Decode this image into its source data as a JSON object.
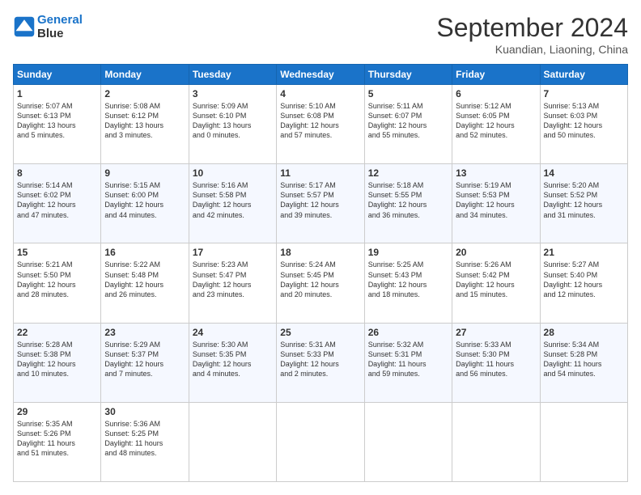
{
  "header": {
    "logo_line1": "General",
    "logo_line2": "Blue",
    "month": "September 2024",
    "location": "Kuandian, Liaoning, China"
  },
  "weekdays": [
    "Sunday",
    "Monday",
    "Tuesday",
    "Wednesday",
    "Thursday",
    "Friday",
    "Saturday"
  ],
  "weeks": [
    [
      {
        "day": "1",
        "lines": [
          "Sunrise: 5:07 AM",
          "Sunset: 6:13 PM",
          "Daylight: 13 hours",
          "and 5 minutes."
        ]
      },
      {
        "day": "2",
        "lines": [
          "Sunrise: 5:08 AM",
          "Sunset: 6:12 PM",
          "Daylight: 13 hours",
          "and 3 minutes."
        ]
      },
      {
        "day": "3",
        "lines": [
          "Sunrise: 5:09 AM",
          "Sunset: 6:10 PM",
          "Daylight: 13 hours",
          "and 0 minutes."
        ]
      },
      {
        "day": "4",
        "lines": [
          "Sunrise: 5:10 AM",
          "Sunset: 6:08 PM",
          "Daylight: 12 hours",
          "and 57 minutes."
        ]
      },
      {
        "day": "5",
        "lines": [
          "Sunrise: 5:11 AM",
          "Sunset: 6:07 PM",
          "Daylight: 12 hours",
          "and 55 minutes."
        ]
      },
      {
        "day": "6",
        "lines": [
          "Sunrise: 5:12 AM",
          "Sunset: 6:05 PM",
          "Daylight: 12 hours",
          "and 52 minutes."
        ]
      },
      {
        "day": "7",
        "lines": [
          "Sunrise: 5:13 AM",
          "Sunset: 6:03 PM",
          "Daylight: 12 hours",
          "and 50 minutes."
        ]
      }
    ],
    [
      {
        "day": "8",
        "lines": [
          "Sunrise: 5:14 AM",
          "Sunset: 6:02 PM",
          "Daylight: 12 hours",
          "and 47 minutes."
        ]
      },
      {
        "day": "9",
        "lines": [
          "Sunrise: 5:15 AM",
          "Sunset: 6:00 PM",
          "Daylight: 12 hours",
          "and 44 minutes."
        ]
      },
      {
        "day": "10",
        "lines": [
          "Sunrise: 5:16 AM",
          "Sunset: 5:58 PM",
          "Daylight: 12 hours",
          "and 42 minutes."
        ]
      },
      {
        "day": "11",
        "lines": [
          "Sunrise: 5:17 AM",
          "Sunset: 5:57 PM",
          "Daylight: 12 hours",
          "and 39 minutes."
        ]
      },
      {
        "day": "12",
        "lines": [
          "Sunrise: 5:18 AM",
          "Sunset: 5:55 PM",
          "Daylight: 12 hours",
          "and 36 minutes."
        ]
      },
      {
        "day": "13",
        "lines": [
          "Sunrise: 5:19 AM",
          "Sunset: 5:53 PM",
          "Daylight: 12 hours",
          "and 34 minutes."
        ]
      },
      {
        "day": "14",
        "lines": [
          "Sunrise: 5:20 AM",
          "Sunset: 5:52 PM",
          "Daylight: 12 hours",
          "and 31 minutes."
        ]
      }
    ],
    [
      {
        "day": "15",
        "lines": [
          "Sunrise: 5:21 AM",
          "Sunset: 5:50 PM",
          "Daylight: 12 hours",
          "and 28 minutes."
        ]
      },
      {
        "day": "16",
        "lines": [
          "Sunrise: 5:22 AM",
          "Sunset: 5:48 PM",
          "Daylight: 12 hours",
          "and 26 minutes."
        ]
      },
      {
        "day": "17",
        "lines": [
          "Sunrise: 5:23 AM",
          "Sunset: 5:47 PM",
          "Daylight: 12 hours",
          "and 23 minutes."
        ]
      },
      {
        "day": "18",
        "lines": [
          "Sunrise: 5:24 AM",
          "Sunset: 5:45 PM",
          "Daylight: 12 hours",
          "and 20 minutes."
        ]
      },
      {
        "day": "19",
        "lines": [
          "Sunrise: 5:25 AM",
          "Sunset: 5:43 PM",
          "Daylight: 12 hours",
          "and 18 minutes."
        ]
      },
      {
        "day": "20",
        "lines": [
          "Sunrise: 5:26 AM",
          "Sunset: 5:42 PM",
          "Daylight: 12 hours",
          "and 15 minutes."
        ]
      },
      {
        "day": "21",
        "lines": [
          "Sunrise: 5:27 AM",
          "Sunset: 5:40 PM",
          "Daylight: 12 hours",
          "and 12 minutes."
        ]
      }
    ],
    [
      {
        "day": "22",
        "lines": [
          "Sunrise: 5:28 AM",
          "Sunset: 5:38 PM",
          "Daylight: 12 hours",
          "and 10 minutes."
        ]
      },
      {
        "day": "23",
        "lines": [
          "Sunrise: 5:29 AM",
          "Sunset: 5:37 PM",
          "Daylight: 12 hours",
          "and 7 minutes."
        ]
      },
      {
        "day": "24",
        "lines": [
          "Sunrise: 5:30 AM",
          "Sunset: 5:35 PM",
          "Daylight: 12 hours",
          "and 4 minutes."
        ]
      },
      {
        "day": "25",
        "lines": [
          "Sunrise: 5:31 AM",
          "Sunset: 5:33 PM",
          "Daylight: 12 hours",
          "and 2 minutes."
        ]
      },
      {
        "day": "26",
        "lines": [
          "Sunrise: 5:32 AM",
          "Sunset: 5:31 PM",
          "Daylight: 11 hours",
          "and 59 minutes."
        ]
      },
      {
        "day": "27",
        "lines": [
          "Sunrise: 5:33 AM",
          "Sunset: 5:30 PM",
          "Daylight: 11 hours",
          "and 56 minutes."
        ]
      },
      {
        "day": "28",
        "lines": [
          "Sunrise: 5:34 AM",
          "Sunset: 5:28 PM",
          "Daylight: 11 hours",
          "and 54 minutes."
        ]
      }
    ],
    [
      {
        "day": "29",
        "lines": [
          "Sunrise: 5:35 AM",
          "Sunset: 5:26 PM",
          "Daylight: 11 hours",
          "and 51 minutes."
        ]
      },
      {
        "day": "30",
        "lines": [
          "Sunrise: 5:36 AM",
          "Sunset: 5:25 PM",
          "Daylight: 11 hours",
          "and 48 minutes."
        ]
      },
      null,
      null,
      null,
      null,
      null
    ]
  ]
}
